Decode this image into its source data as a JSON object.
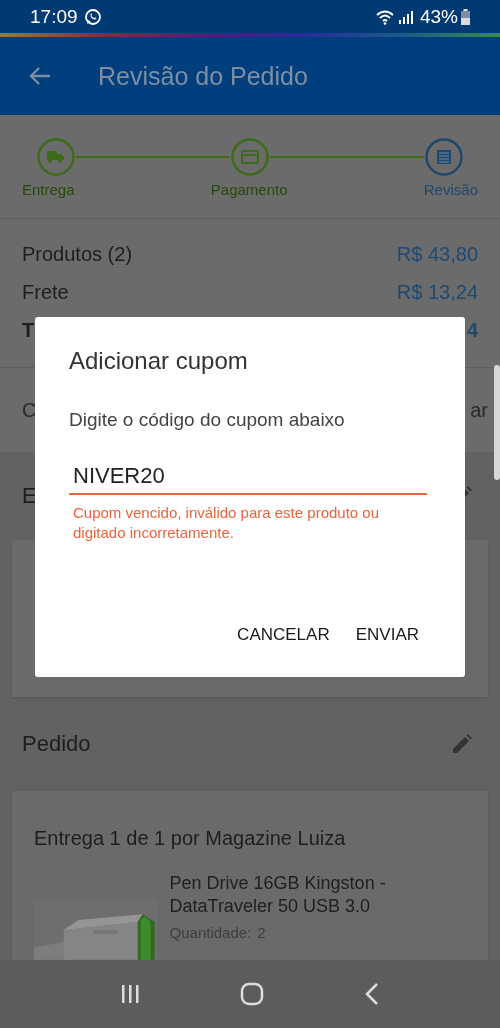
{
  "status_bar": {
    "time": "17:09",
    "battery": "43%"
  },
  "app_bar": {
    "title": "Revisão do Pedido"
  },
  "steps": [
    {
      "label": "Entrega",
      "kind": "truck",
      "selected": false
    },
    {
      "label": "Pagamento",
      "kind": "card",
      "selected": false
    },
    {
      "label": "Revisão",
      "kind": "list",
      "selected": true
    }
  ],
  "summary": [
    {
      "label": "Produtos (2)",
      "value": "R$ 43,80",
      "bold": false
    },
    {
      "label": "Frete",
      "value": "R$ 13,24",
      "bold": false
    },
    {
      "label": "T",
      "value": "4",
      "bold": true
    }
  ],
  "coupon_row": {
    "label": "C",
    "action": "ar"
  },
  "delivery_section": {
    "title": "E"
  },
  "order_section": {
    "title": "Pedido",
    "shipment": "Entrega 1 de 1 por Magazine Luiza",
    "product": {
      "name": "Pen Drive 16GB Kingston - DataTraveler 50 USB 3.0",
      "quantity_label": "Quantidade:",
      "quantity": "2"
    }
  },
  "dialog": {
    "title": "Adicionar cupom",
    "message": "Digite o código do cupom abaixo",
    "field": {
      "value": "NIVER20",
      "invalid": true,
      "error": "Cupom vencido, inválido para este produto ou digitado incorretamente."
    },
    "buttons": [
      "CANCELAR",
      "ENVIAR"
    ]
  }
}
